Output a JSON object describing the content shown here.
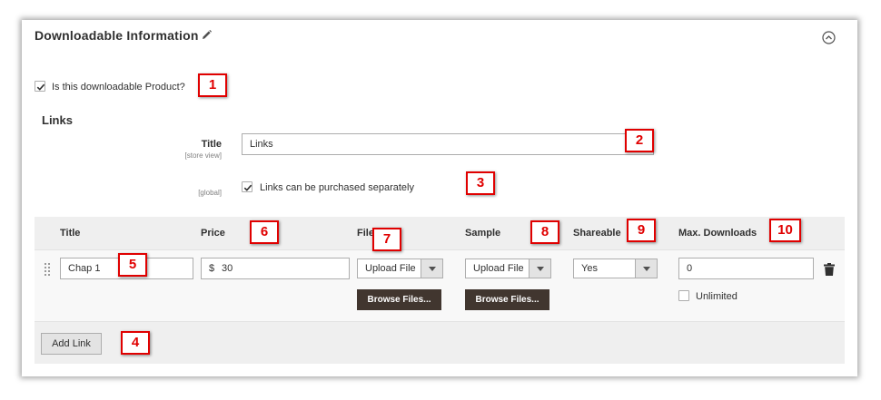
{
  "section": {
    "title": "Downloadable Information"
  },
  "downloadable": {
    "checkbox_label": "Is this downloadable Product?",
    "checked": true
  },
  "links": {
    "heading": "Links",
    "title_label": "Title",
    "title_scope": "[store view]",
    "title_value": "Links",
    "purchase_scope": "[global]",
    "purchase_label": "Links can be purchased separately",
    "purchase_checked": true
  },
  "table": {
    "columns": [
      "Title",
      "Price",
      "File",
      "Sample",
      "Shareable",
      "Max. Downloads"
    ],
    "row": {
      "title_value": "Chap 1",
      "price_currency": "$",
      "price_value": "30",
      "file_select": "Upload File",
      "file_browse": "Browse Files...",
      "sample_select": "Upload File",
      "sample_browse": "Browse Files...",
      "shareable": "Yes",
      "max_downloads": "0",
      "unlimited_label": "Unlimited",
      "unlimited_checked": false
    },
    "add_link_label": "Add Link"
  },
  "callouts": [
    "1",
    "2",
    "3",
    "4",
    "5",
    "6",
    "7",
    "8",
    "9",
    "10"
  ],
  "colors": {
    "callout_red": "#e00000",
    "browse_button": "#41362f",
    "table_background": "#efefef"
  }
}
